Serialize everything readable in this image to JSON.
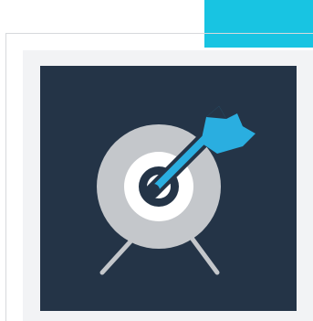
{
  "colors": {
    "page_background": "#ffffff",
    "accent": "#18c4e2",
    "card_fill": "#f2f3f5",
    "card_border": "#d6d9dc",
    "tile_background": "#243447",
    "target_outer": "#c4c7cb",
    "target_inner_white": "#ffffff",
    "target_center": "#243447",
    "dart": "#2aaee0",
    "dart_outline": "#243447"
  },
  "icon": {
    "name": "target-dart-icon"
  }
}
